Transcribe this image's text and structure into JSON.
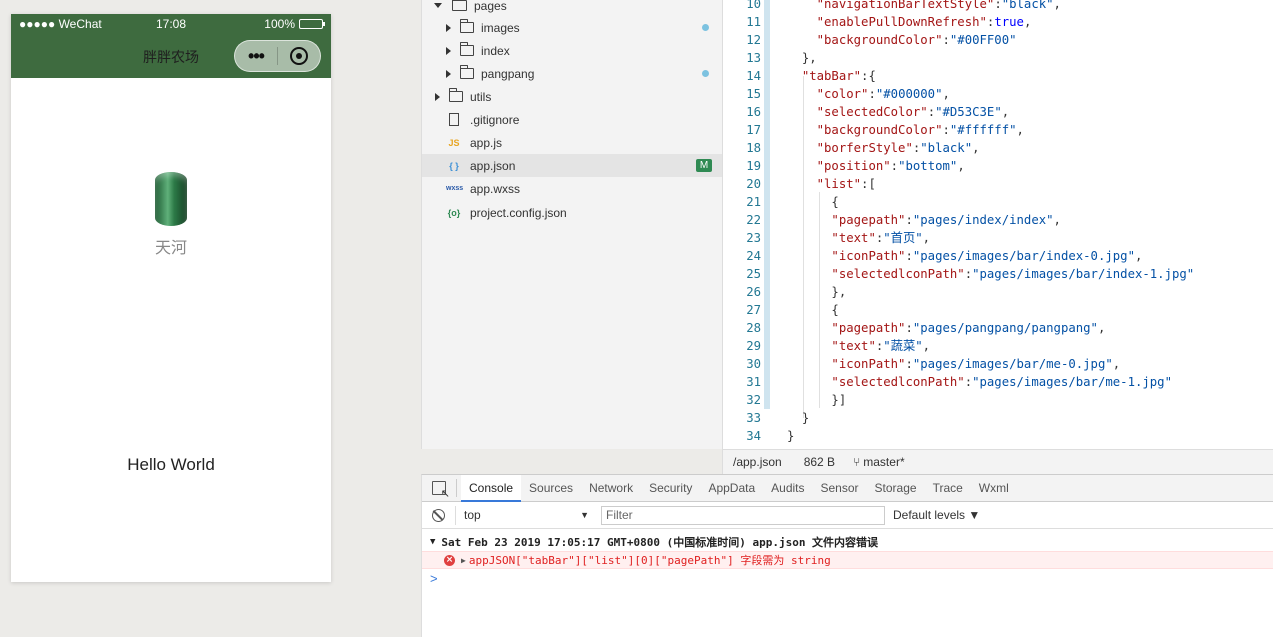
{
  "simulator": {
    "carrier": "●●●●● WeChat",
    "time": "17:08",
    "battery": "100%",
    "nav_title": "胖胖农场",
    "capsule_more": "•••",
    "nickname": "天河",
    "hello": "Hello World"
  },
  "filetree": {
    "items": [
      {
        "label": "pages",
        "kind": "folder-open"
      },
      {
        "label": "images",
        "kind": "folder"
      },
      {
        "label": "index",
        "kind": "folder"
      },
      {
        "label": "pangpang",
        "kind": "folder"
      },
      {
        "label": "utils",
        "kind": "folder"
      },
      {
        "label": ".gitignore",
        "kind": "file"
      },
      {
        "label": "app.js",
        "kind": "js",
        "icon": "JS"
      },
      {
        "label": "app.json",
        "kind": "json",
        "icon": "{ }",
        "badge": "M"
      },
      {
        "label": "app.wxss",
        "kind": "wxss",
        "icon": "wxss"
      },
      {
        "label": "project.config.json",
        "kind": "config",
        "icon": "{o}"
      }
    ]
  },
  "editor": {
    "lines": [
      {
        "n": "10",
        "text": "    \"navigationBarTextStyle\":\"black\","
      },
      {
        "n": "11",
        "text": "    \"enablePullDownRefresh\":true,"
      },
      {
        "n": "12",
        "text": "    \"backgroundColor\":\"#00FF00\""
      },
      {
        "n": "13",
        "text": "  },"
      },
      {
        "n": "14",
        "text": "  \"tabBar\":{"
      },
      {
        "n": "15",
        "text": "    \"color\":\"#000000\","
      },
      {
        "n": "16",
        "text": "    \"selectedColor\":\"#D53C3E\","
      },
      {
        "n": "17",
        "text": "    \"backgroundColor\":\"#ffffff\","
      },
      {
        "n": "18",
        "text": "    \"borferStyle\":\"black\","
      },
      {
        "n": "19",
        "text": "    \"position\":\"bottom\","
      },
      {
        "n": "20",
        "text": "    \"list\":["
      },
      {
        "n": "21",
        "text": "      {"
      },
      {
        "n": "22",
        "text": "      \"pagepath\":\"pages/index/index\","
      },
      {
        "n": "23",
        "text": "      \"text\":\"首页\","
      },
      {
        "n": "24",
        "text": "      \"iconPath\":\"pages/images/bar/index-0.jpg\","
      },
      {
        "n": "25",
        "text": "      \"selectedlconPath\":\"pages/images/bar/index-1.jpg\""
      },
      {
        "n": "26",
        "text": "      },"
      },
      {
        "n": "27",
        "text": "      {"
      },
      {
        "n": "28",
        "text": "      \"pagepath\":\"pages/pangpang/pangpang\","
      },
      {
        "n": "29",
        "text": "      \"text\":\"蔬菜\","
      },
      {
        "n": "30",
        "text": "      \"iconPath\":\"pages/images/bar/me-0.jpg\","
      },
      {
        "n": "31",
        "text": "      \"selectedlconPath\":\"pages/images/bar/me-1.jpg\""
      },
      {
        "n": "32",
        "text": "      }]"
      },
      {
        "n": "33",
        "text": "  }"
      },
      {
        "n": "34",
        "text": "}"
      }
    ],
    "status": {
      "path": "/app.json",
      "size": "862 B",
      "branch": "master*"
    }
  },
  "devtools": {
    "tabs": [
      "Console",
      "Sources",
      "Network",
      "Security",
      "AppData",
      "Audits",
      "Sensor",
      "Storage",
      "Trace",
      "Wxml"
    ],
    "active_tab": "Console",
    "context": "top",
    "filter_placeholder": "Filter",
    "levels": "Default levels ▼",
    "log_group": "Sat Feb 23 2019 17:05:17 GMT+0800 (中国标准时间)  app.json 文件内容错误",
    "error_message": "appJSON[\"tabBar\"][\"list\"][0][\"pagePath\"] 字段需为 string",
    "prompt": ">"
  },
  "colors": {
    "nav_green": "#3e6b3f",
    "badge_green": "#2f8a53",
    "error_red": "#e02020",
    "accent_blue": "#3879d9"
  }
}
